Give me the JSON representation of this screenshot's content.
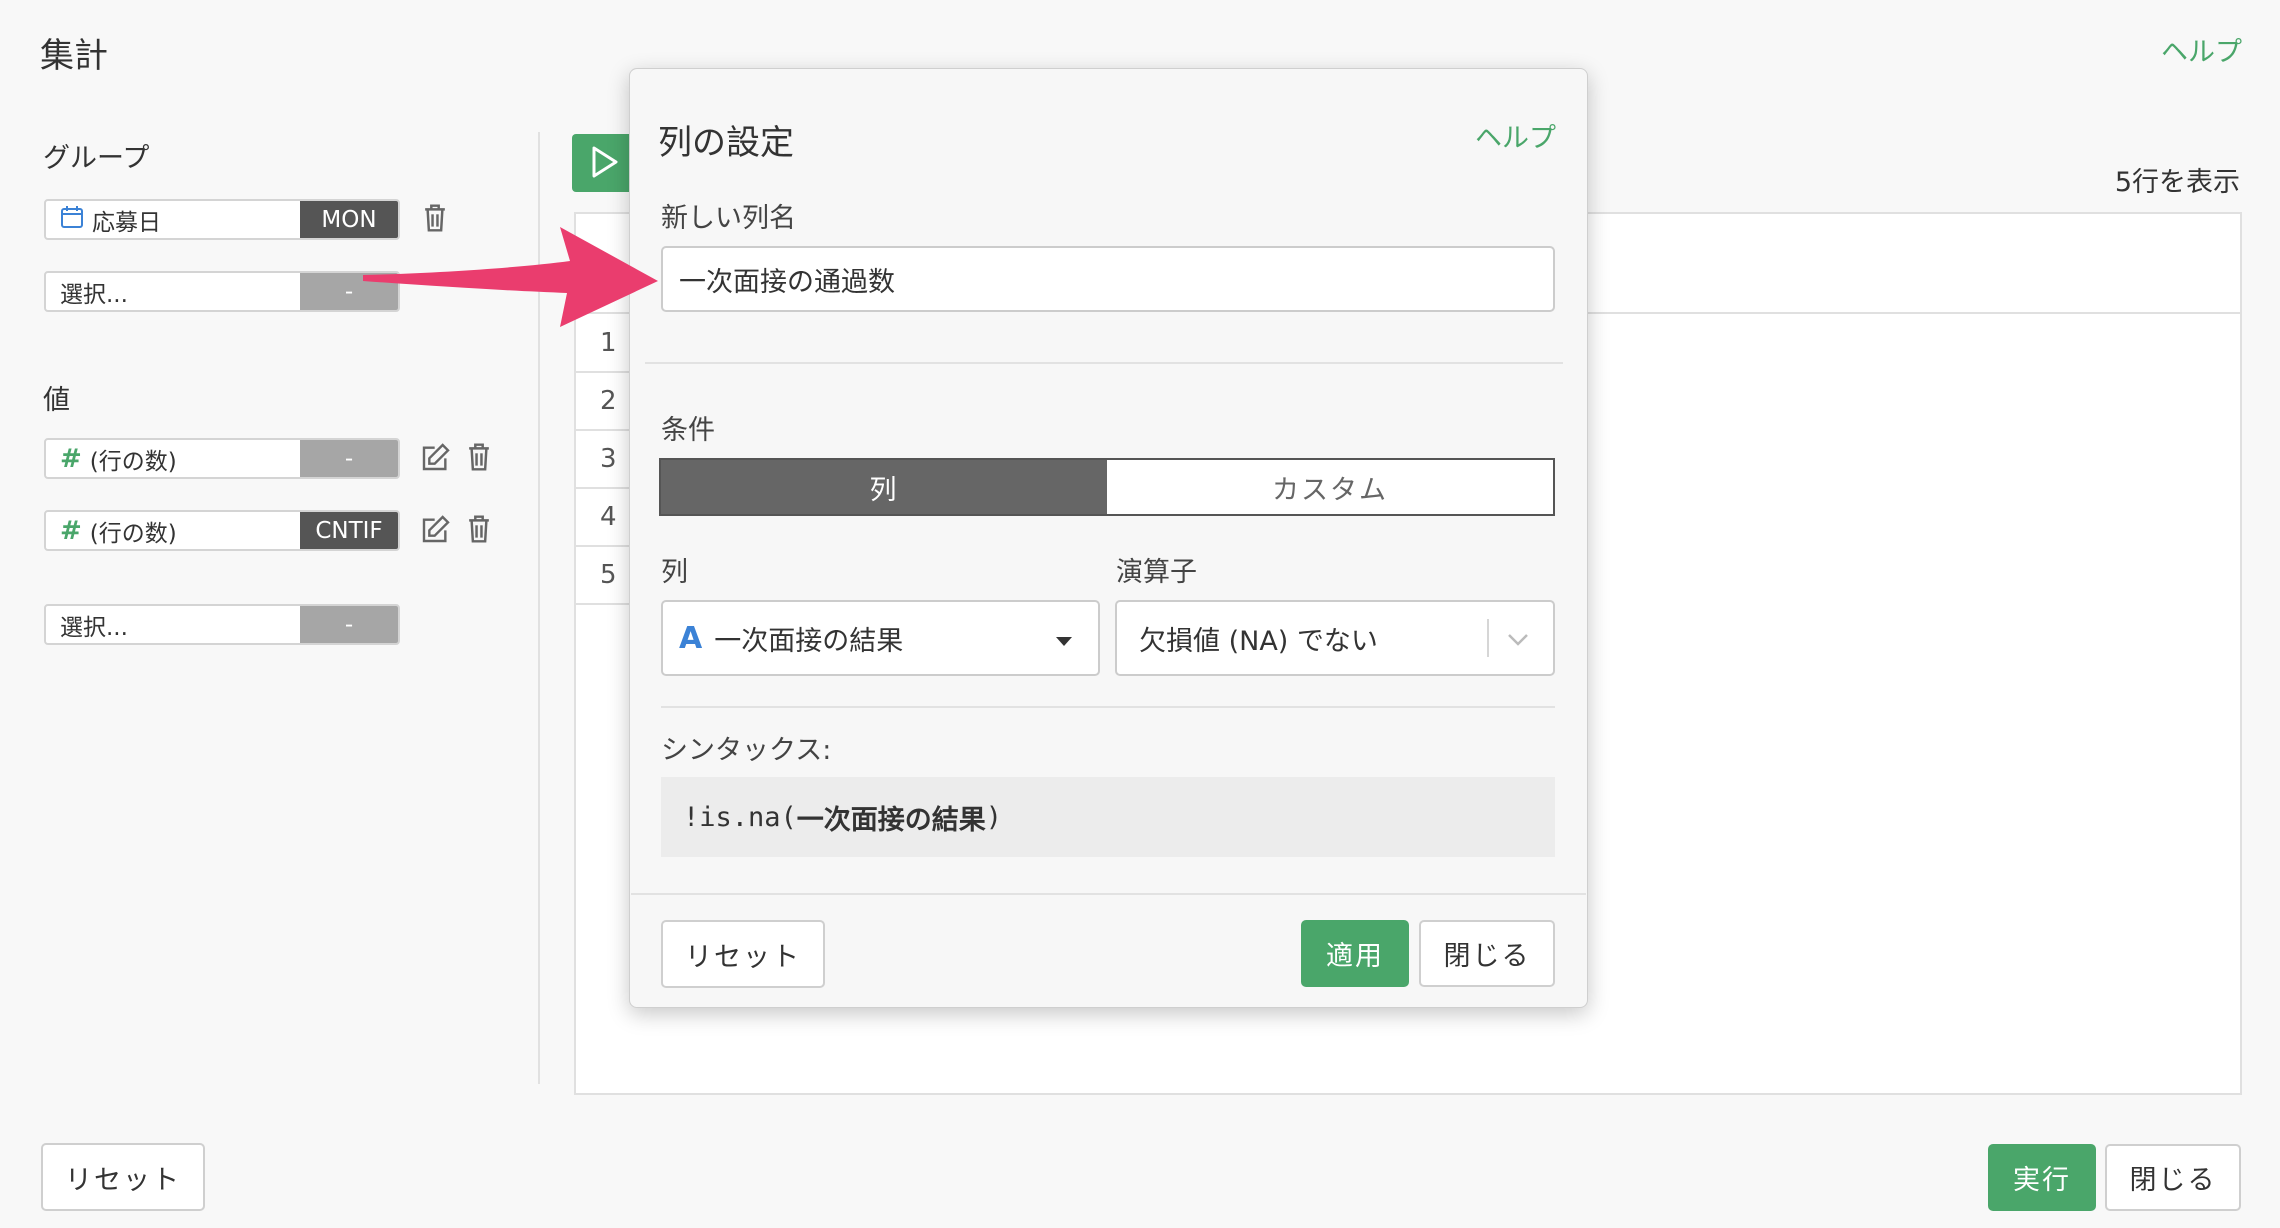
{
  "page": {
    "title": "集計",
    "help": "ヘルプ",
    "rows_shown": "5行を表示",
    "reset_label": "リセット",
    "run_label": "実行",
    "close_label": "閉じる"
  },
  "group": {
    "label": "グループ",
    "items": [
      {
        "name": "応募日",
        "tag": "MON",
        "icon": "calendar-icon"
      },
      {
        "name": "選択...",
        "tag": "-"
      }
    ]
  },
  "values": {
    "label": "値",
    "items": [
      {
        "name": "(行の数)",
        "tag": "-",
        "icon": "hash-icon"
      },
      {
        "name": "(行の数)",
        "tag": "CNTIF",
        "icon": "hash-icon"
      },
      {
        "name": "選択...",
        "tag": "-"
      }
    ]
  },
  "preview": {
    "row_numbers": [
      "1",
      "2",
      "3",
      "4",
      "5"
    ]
  },
  "modal": {
    "title": "列の設定",
    "help": "ヘルプ",
    "new_column_label": "新しい列名",
    "new_column_value": "一次面接の通過数",
    "condition_label": "条件",
    "tabs": [
      "列",
      "カスタム"
    ],
    "column_label": "列",
    "column_value": "一次面接の結果",
    "column_type_badge": "A",
    "operator_label": "演算子",
    "operator_value": "欠損値 (NA) でない",
    "syntax_label": "シンタックス:",
    "syntax_prefix": "!is.na(",
    "syntax_bold": "一次面接の結果",
    "syntax_suffix": ")",
    "reset_label": "リセット",
    "apply_label": "適用",
    "close_label": "閉じる"
  },
  "colors": {
    "accent": "#4aa66a",
    "dark_tag": "#555555",
    "gray_tag": "#a6a6a6",
    "arrow": "#ea3d6e"
  }
}
